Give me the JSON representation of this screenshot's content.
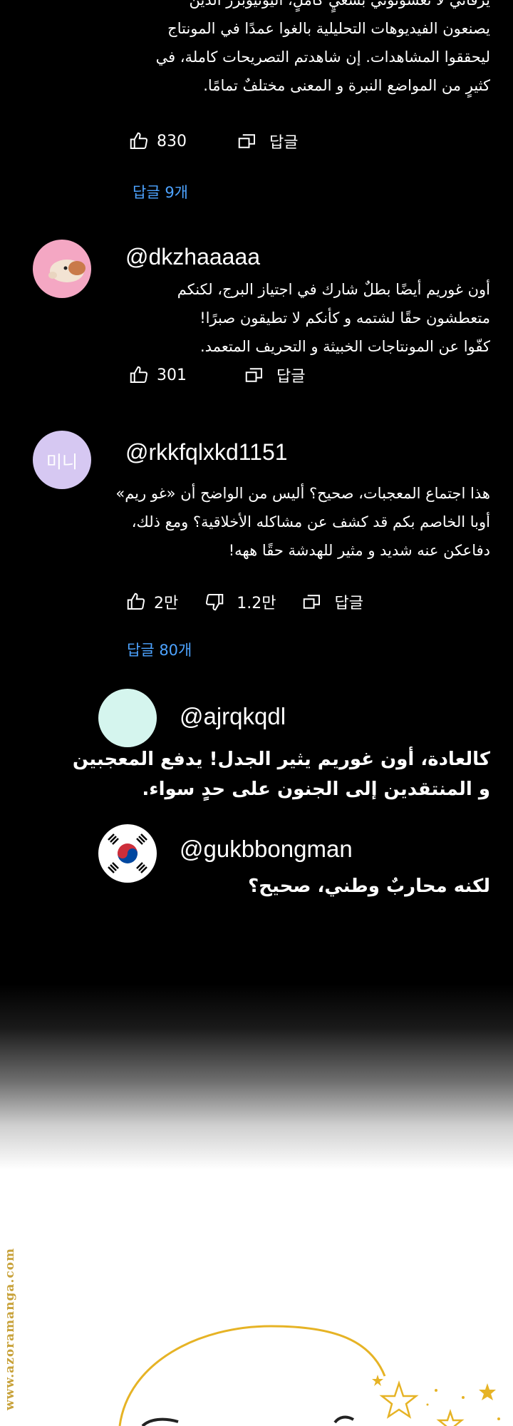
{
  "comment0": {
    "lines": [
      "يرقاني لا تعسونوني بسعيٍ كاملٍ، اليوتيوبرز الذين",
      "يصنعون الفيديوهات التحليلية بالغوا عمدًا في المونتاج",
      "ليحققوا المشاهدات. إن شاهدتم التصريحات كاملة، في",
      "كثيرٍ من المواضع النبرة و المعنى مختلفٌ تمامًا."
    ],
    "likes": "830",
    "reply_label": "답글",
    "replies_link": "답글 9개"
  },
  "comment1": {
    "handle": "@dkzhaaaaa",
    "lines": [
      "أون غوريم أيضًا بطلٌ شارك في اجتياز البرج، لكنكم",
      "متعطشون حقًا لشتمه و كأنكم لا تطيقون صبرًا!",
      "كفّوا عن المونتاجات الخبيثة و التحريف المتعمد."
    ],
    "likes": "301",
    "reply_label": "답글"
  },
  "comment2": {
    "handle": "@rkkfqlxkd1151",
    "avatar_text": "미니",
    "lines": [
      "هذا اجتماع المعجبات، صحيح؟ أليس من الواضح أن «غو ريم»",
      "أوبا الخاصم بكم قد كشف عن مشاكله الأخلاقية؟ ومع ذلك،",
      "دفاعكن عنه شديد و مثير للهدشة حقًا ههه!"
    ],
    "likes": "2만",
    "dislikes": "1.2만",
    "reply_label": "답글",
    "replies_link": "답글 80개"
  },
  "reply1": {
    "handle": "@ajrqkqdl",
    "lines": [
      "كالعادة، أون غوريم يثير الجدل! يدفع المعجبين",
      "و المنتقدين إلى الجنون على حدٍ سواء."
    ]
  },
  "reply2": {
    "handle": "@gukbbongman",
    "lines": [
      "لكنه محاربٌ وطني، صحيح؟"
    ]
  },
  "watermark": "www.azoramanga.com",
  "colors": {
    "link": "#4da3ff",
    "mint_avatar": "#d5f5ee",
    "purple_avatar": "#d6c8f2",
    "pink_avatar": "#f4a7c3",
    "gold": "#e6b325"
  },
  "icons": [
    "thumb-up-icon",
    "thumb-down-icon",
    "reply-icon",
    "star-icon"
  ]
}
